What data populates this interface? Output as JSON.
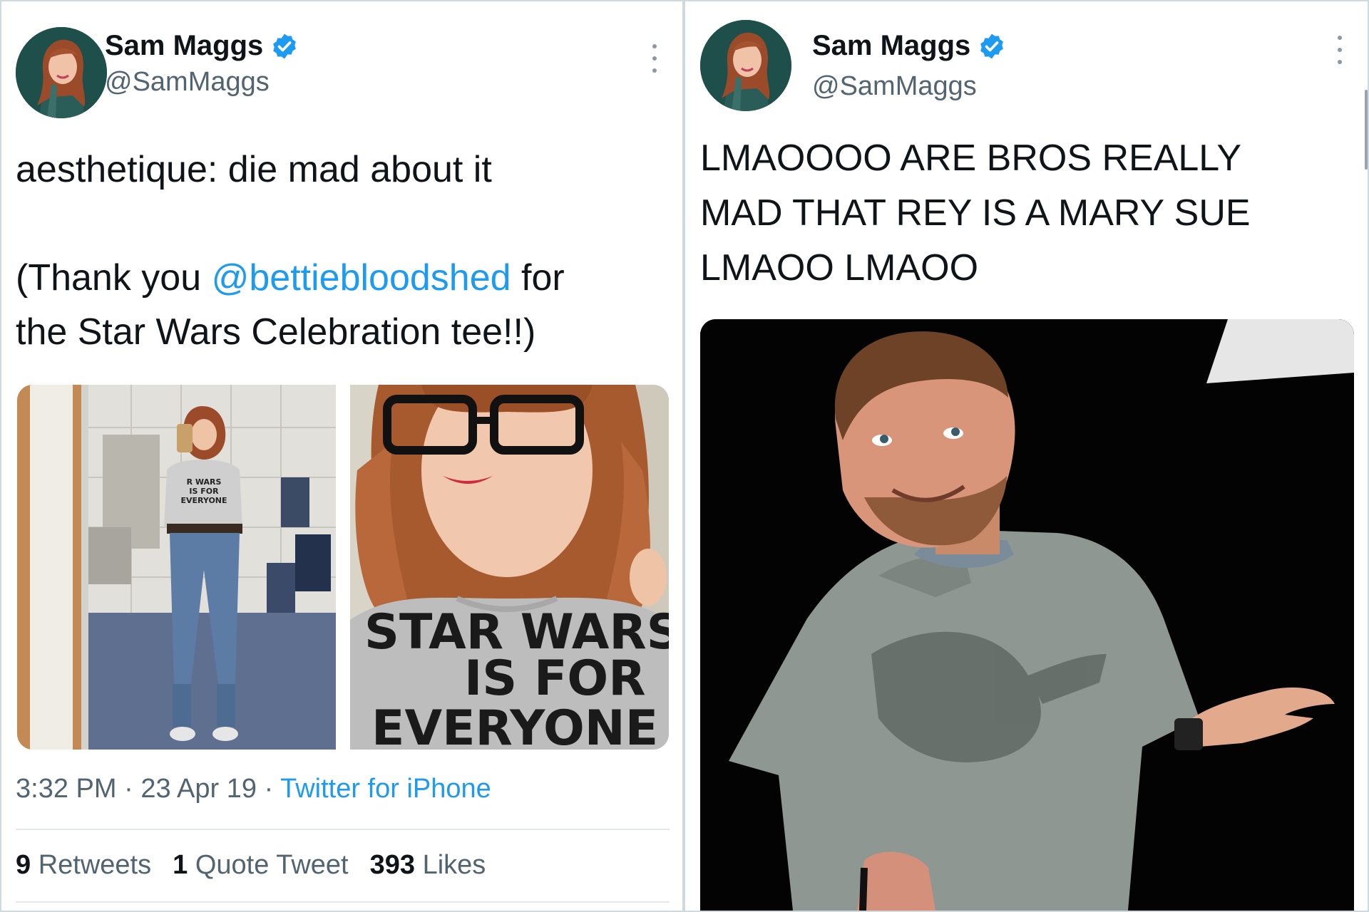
{
  "left_tweet": {
    "name": "Sam Maggs",
    "handle": "@SamMaggs",
    "text_line1": "aesthetique: die mad about it",
    "text_line2_prefix": "(Thank you ",
    "mention": "@bettiebloodshed",
    "text_line2_suffix": " for",
    "text_line3": "the Star Wars Celebration tee!!)",
    "photo1_shirt_text": [
      "R WARS",
      "IS FOR",
      "EVERYONE"
    ],
    "photo2_shirt_text": [
      "STAR WARS",
      "IS FOR",
      "EVERYONE"
    ],
    "time": "3:32 PM",
    "date": "23 Apr 19",
    "separator": "·",
    "source": "Twitter for iPhone",
    "retweets_count": "9",
    "retweets_label": "Retweets",
    "quotes_count": "1",
    "quotes_label": "Quote Tweet",
    "likes_count": "393",
    "likes_label": "Likes"
  },
  "right_tweet": {
    "name": "Sam Maggs",
    "handle": "@SamMaggs",
    "text_line1": "LMAOOOO ARE BROS REALLY",
    "text_line2": "MAD THAT REY IS A MARY SUE",
    "text_line3": "LMAOO LMAOO"
  },
  "colors": {
    "link": "#1d9bf0",
    "verified": "#1d9bf0",
    "secondary_text": "#536471",
    "primary_text": "#0f1419"
  }
}
